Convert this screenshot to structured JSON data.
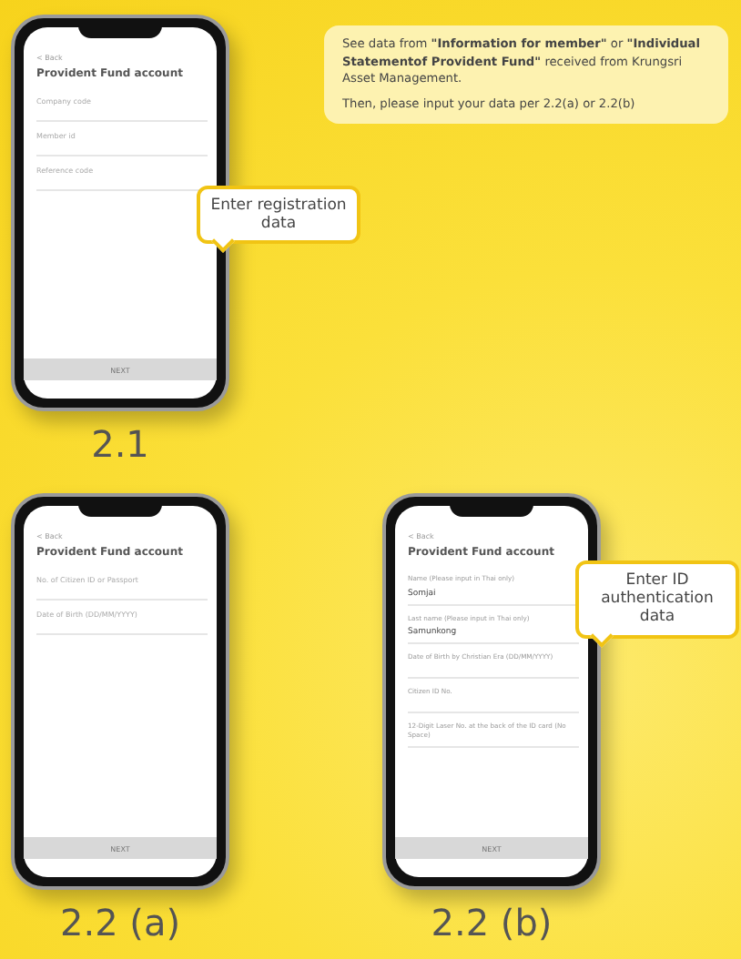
{
  "note": {
    "lines": [
      "See data from **\"Information for member\"** or **\"Individual Statementof Provident Fund\"** received from Krungsri Asset Management.",
      "Then, please input your data per 2.2(a) or 2.2(b)"
    ]
  },
  "phones": [
    {
      "step": "2.1",
      "back": "< Back",
      "title": "Provident Fund account",
      "button": "NEXT",
      "callout": "Enter registration data",
      "fields": [
        {
          "placeholder": "Company code"
        },
        {
          "placeholder": "Member id"
        },
        {
          "placeholder": "Reference code"
        }
      ]
    },
    {
      "step": "2.2 (a)",
      "back": "< Back",
      "title": "Provident Fund account",
      "button": "NEXT",
      "fields": [
        {
          "placeholder": "No. of Citizen ID or Passport"
        },
        {
          "placeholder": "Date of Birth (DD/MM/YYYY)"
        }
      ]
    },
    {
      "step": "2.2 (b)",
      "back": "< Back",
      "title": "Provident Fund account",
      "button": "NEXT",
      "callout": "Enter ID authentication data",
      "fields": [
        {
          "label": "Name (Please input in Thai only)",
          "value": "Somjai"
        },
        {
          "label": "Last name (Please input in Thai only)",
          "value": "Samunkong"
        },
        {
          "label": "Date of Birth by Christian Era (DD/MM/YYYY)"
        },
        {
          "label": "Citizen ID No."
        },
        {
          "label": "12-Digit Laser No. at the back of the ID card (No Space)"
        }
      ]
    }
  ]
}
